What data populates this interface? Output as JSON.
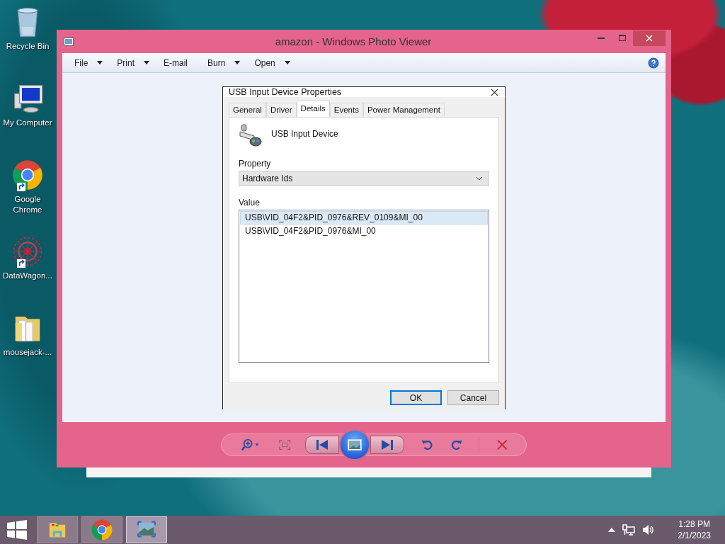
{
  "desktop_icons": [
    {
      "kind": "recycle",
      "label": "Recycle Bin",
      "shortcut": false
    },
    {
      "kind": "computer",
      "label": "My Computer",
      "shortcut": false
    },
    {
      "kind": "chrome",
      "label": "Google Chrome",
      "shortcut": true
    },
    {
      "kind": "mandala",
      "label": "DataWagon...",
      "shortcut": true
    },
    {
      "kind": "folder",
      "label": "mousejack-...",
      "shortcut": false
    }
  ],
  "window": {
    "title": "amazon - Windows Photo Viewer",
    "menu": [
      {
        "label": "File",
        "dropdown": true
      },
      {
        "label": "Print",
        "dropdown": true
      },
      {
        "label": "E-mail",
        "dropdown": false
      },
      {
        "label": "Burn",
        "dropdown": true
      },
      {
        "label": "Open",
        "dropdown": true
      }
    ]
  },
  "dialog": {
    "title": "USB Input Device Properties",
    "tabs": [
      {
        "label": "General",
        "selected": false
      },
      {
        "label": "Driver",
        "selected": false
      },
      {
        "label": "Details",
        "selected": true
      },
      {
        "label": "Events",
        "selected": false
      },
      {
        "label": "Power Management",
        "selected": false
      }
    ],
    "device_name": "USB Input Device",
    "property_label": "Property",
    "property_value": "Hardware Ids",
    "value_label": "Value",
    "values": [
      {
        "text": "USB\\VID_04F2&PID_0976&REV_0109&MI_00",
        "selected": true
      },
      {
        "text": "USB\\VID_04F2&PID_0976&MI_00",
        "selected": false
      }
    ],
    "buttons": [
      {
        "label": "OK",
        "default": true
      },
      {
        "label": "Cancel",
        "default": false
      }
    ]
  },
  "taskbar": {
    "apps": [
      {
        "kind": "explorer",
        "active": false
      },
      {
        "kind": "chrome",
        "active": false
      },
      {
        "kind": "photos",
        "active": true
      }
    ],
    "time": "1:28 PM",
    "date": "2/1/2023"
  }
}
